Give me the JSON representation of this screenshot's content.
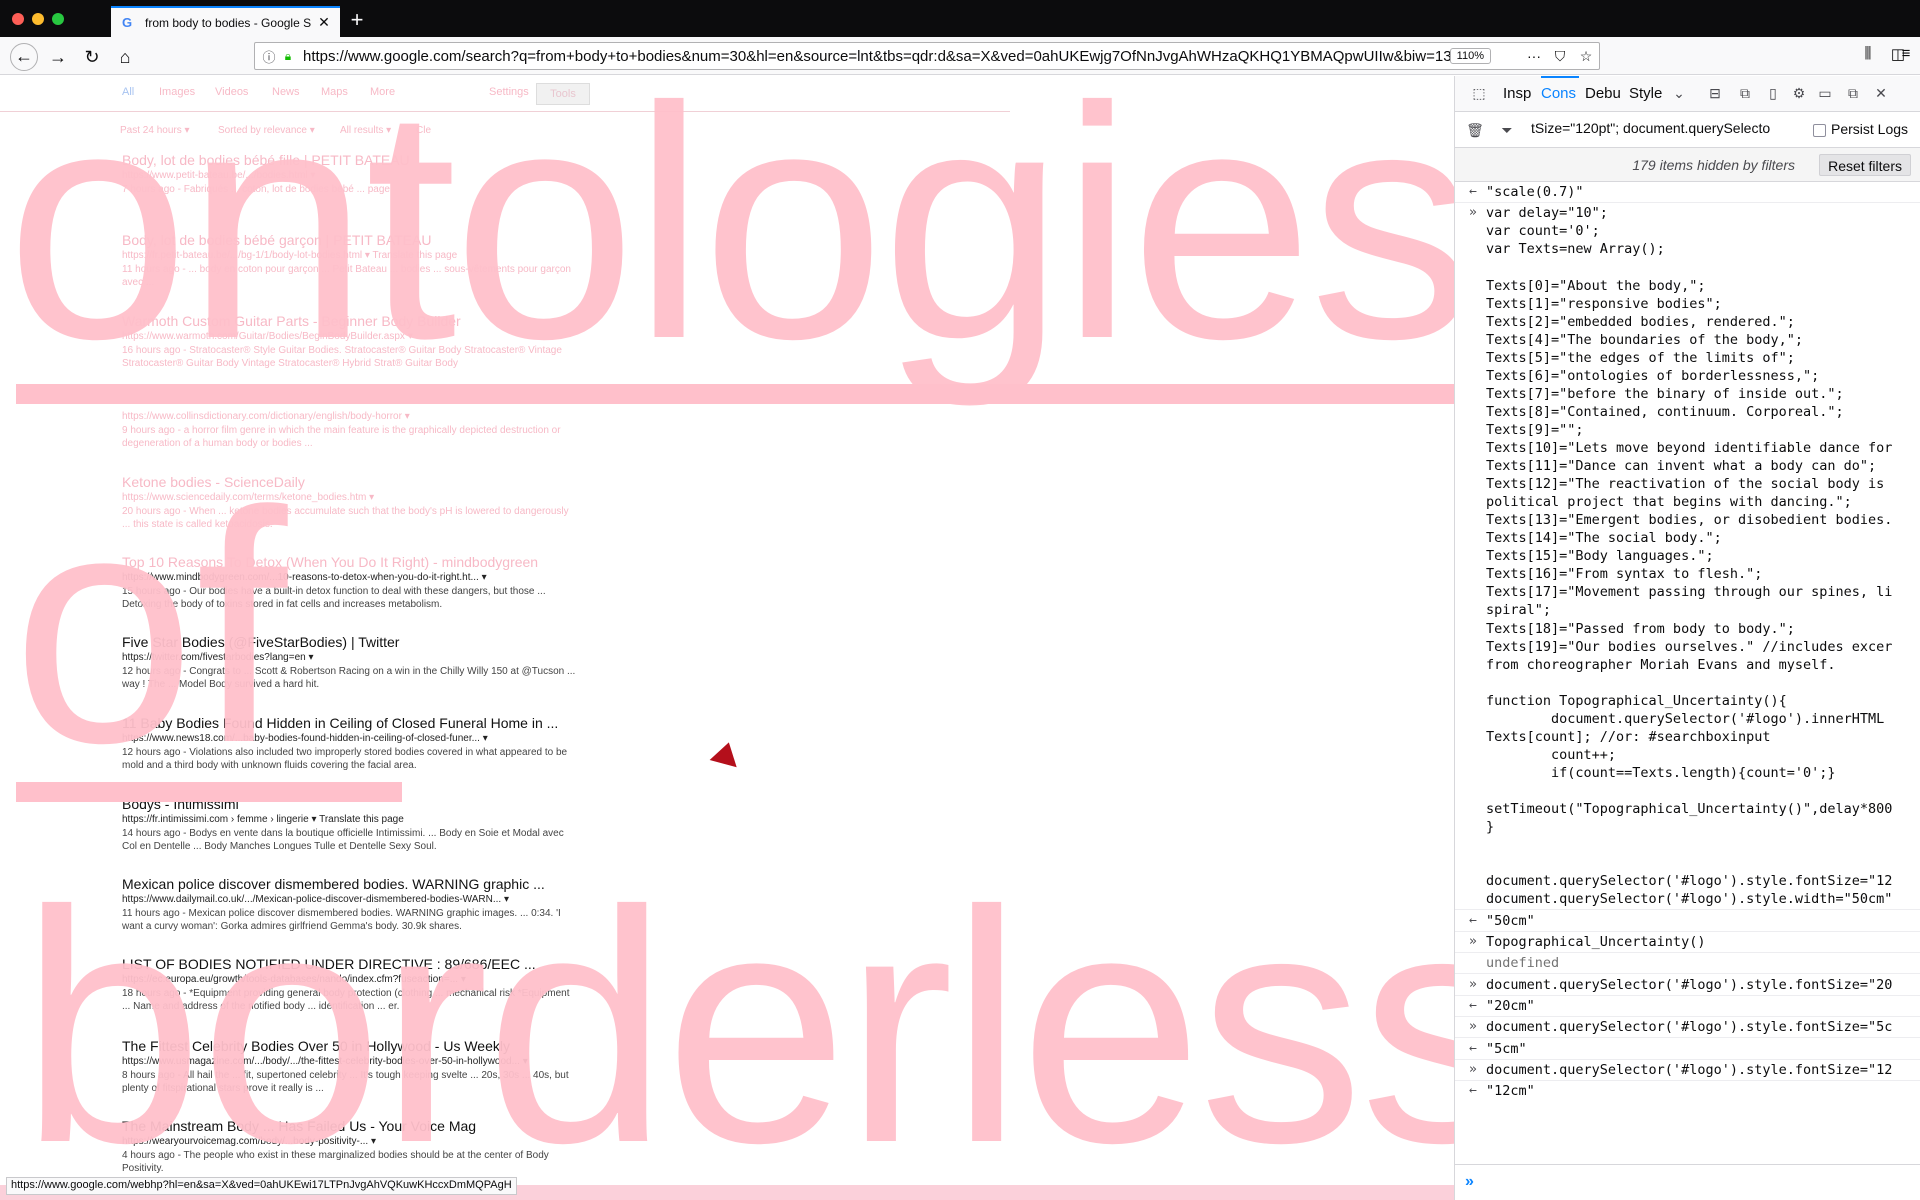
{
  "browser": {
    "tab_title": "from body to bodies - Google S",
    "tab_favicon": "G",
    "tab_close": "✕",
    "new_tab": "+",
    "url": "https://www.google.com/search?q=from+body+to+bodies&num=30&hl=en&source=lnt&tbs=qdr:d&sa=X&ved=0ahUKEwjg7OfNnJvgAhWHzaQKHQ1YBMAQpwUIIw&biw=1318&bih=1026",
    "zoom": "110%",
    "status_url": "https://www.google.com/webhp?hl=en&sa=X&ved=0ahUKEwi17LTPnJvgAhVQKuwKHccxDmMQPAgH"
  },
  "google": {
    "tabs": [
      "All",
      "Images",
      "Videos",
      "News",
      "Maps",
      "More"
    ],
    "settings": "Settings",
    "tools": "Tools",
    "filters": [
      "Past 24 hours ▾",
      "Sorted by relevance ▾",
      "All results ▾",
      "Cle"
    ],
    "results": [
      {
        "title": "Body, lot de bodies bébé fille | PETIT BATEAU",
        "url": "https://www.petit-bateau.be/.../bodies.html ▾",
        "snippet": "7 hours ago - Fabriqués ... coton, lot de bodies bébé ... page"
      },
      {
        "title": "Body, lot de bodies bébé garçon | PETIT BATEAU",
        "url": "https://fr.petit-bateau.be/.../bg-1/1/body-lot-bodies.html ▾ Translate this page",
        "snippet": "11 hours ago - ... body en coton pour garçon ... Petit Bateau ... bodies ... sous-vêtements pour garçon avec ..."
      },
      {
        "title": "Warmoth Custom Guitar Parts - Beginner Body Builder",
        "url": "https://www.warmoth.com/Guitar/Bodies/BeginBodyBuilder.aspx ▾",
        "snippet": "16 hours ago - Stratocaster® Style Guitar Bodies. Stratocaster® Guitar Body Stratocaster® Vintage Stratocaster® Guitar Body Vintage Stratocaster® Hybrid Strat® Guitar Body"
      },
      {
        "title": "",
        "url": "https://www.collinsdictionary.com/dictionary/english/body-horror ▾",
        "snippet": "9 hours ago - a horror film genre in which the main feature is the graphically depicted destruction or degeneration of a human body or bodies ..."
      },
      {
        "title": "Ketone bodies - ScienceDaily",
        "url": "https://www.sciencedaily.com/terms/ketone_bodies.htm ▾",
        "snippet": "20 hours ago - When ... ketone bodies accumulate such that the body's pH is lowered to dangerously ... this state is called ketoacidosis."
      },
      {
        "title": "Top 10 Reasons To Detox (When You Do It Right) - mindbodygreen",
        "url": "https://www.mindbodygreen.com/...10-reasons-to-detox-when-you-do-it-right.ht... ▾",
        "snippet": "15 hours ago - Our bodies have a built-in detox function to deal with these dangers, but those ... Detoxing the body of toxins stored in fat cells and increases metabolism."
      },
      {
        "title": "Five Star Bodies (@FiveStarBodies) | Twitter",
        "url": "https://twitter.com/fivestarbodies?lang=en ▾",
        "snippet": "12 hours ago - Congrats to ... Scott & Robertson Racing on a win in the Chilly Willy 150 at @Tucson ... way ! The ... Model Body survived a hard hit."
      },
      {
        "title": "11 Baby Bodies Found Hidden in Ceiling of Closed Funeral Home in ...",
        "url": "https://www.news18.com/...baby-bodies-found-hidden-in-ceiling-of-closed-funer... ▾",
        "snippet": "12 hours ago - Violations also included two improperly stored bodies covered in what appeared to be mold and a third body with unknown fluids covering the facial area."
      },
      {
        "title": "Bodys - Intimissimi",
        "url": "https://fr.intimissimi.com › femme › lingerie ▾ Translate this page",
        "snippet": "14 hours ago - Bodys en vente dans la boutique officielle Intimissimi. ... Body en Soie et Modal avec Col en Dentelle ... Body Manches Longues Tulle et Dentelle Sexy Soul."
      },
      {
        "title": "Mexican police discover dismembered bodies. WARNING graphic ...",
        "url": "https://www.dailymail.co.uk/.../Mexican-police-discover-dismembered-bodies-WARN... ▾",
        "snippet": "11 hours ago - Mexican police discover dismembered bodies. WARNING graphic images. ... 0:34. 'I want a curvy woman': Gorka admires girlfriend Gemma's body. 30.9k shares."
      },
      {
        "title": "LIST OF BODIES NOTIFIED UNDER DIRECTIVE : 89/686/EEC ...",
        "url": "https://ec.europa.eu/growth/tools-databases/nando/index.cfm?fuseaction=... ▾",
        "snippet": "18 hours ago - *Equipment providing general body protection (clothing ... mechanical risk *Equipment ... Name and address of the notified body ... identification ... er."
      },
      {
        "title": "The Fittest Celebrity Bodies Over 50 in Hollywood - Us Weekly",
        "url": "https://www.usmagazine.com/.../body/.../the-fittest-celebrity-bodies-over-50-in-hollywood... ▾",
        "snippet": "8 hours ago - All hail the ... fit, supertoned celebrity ... It's tough keeping svelte ... 20s, 30s ... 40s, but plenty of fitspirational stars prove it really is ..."
      },
      {
        "title": "The Mainstream Body ... Has Failed Us - Your Voice Mag",
        "url": "https://wearyourvoicemag.com/body/...body-positivity-... ▾",
        "snippet": "4 hours ago - The people who exist in these marginalized bodies should be at the center of Body Positivity."
      }
    ]
  },
  "logo_overlay": {
    "words": [
      "ontologies",
      "of",
      "borderless"
    ],
    "color": "#ffc0cb"
  },
  "devtools": {
    "tabs": [
      "Insp",
      "Cons",
      "Debu",
      "Style"
    ],
    "filter_text": "tSize=\"120pt\"; document.querySelecto",
    "persist_logs": "Persist Logs",
    "hidden_text": "179 items hidden by filters",
    "reset_filters": "Reset filters",
    "console_lines": [
      {
        "kind": "out",
        "pfx": "←",
        "text": "\"scale(0.7)\""
      },
      {
        "kind": "in",
        "pfx": "»",
        "text": "var delay=\"10\";"
      },
      {
        "kind": "cont",
        "pfx": "",
        "text": "var count='0';"
      },
      {
        "kind": "cont",
        "pfx": "",
        "text": "var Texts=new Array();"
      },
      {
        "kind": "cont",
        "pfx": "",
        "text": ""
      },
      {
        "kind": "cont",
        "pfx": "",
        "text": "Texts[0]=\"About the body,\";"
      },
      {
        "kind": "cont",
        "pfx": "",
        "text": "Texts[1]=\"responsive bodies\";"
      },
      {
        "kind": "cont",
        "pfx": "",
        "text": "Texts[2]=\"embedded bodies, rendered.\";"
      },
      {
        "kind": "cont",
        "pfx": "",
        "text": "Texts[4]=\"The boundaries of the body,\";"
      },
      {
        "kind": "cont",
        "pfx": "",
        "text": "Texts[5]=\"the edges of the limits of\";"
      },
      {
        "kind": "cont",
        "pfx": "",
        "text": "Texts[6]=\"ontologies of borderlessness,\";"
      },
      {
        "kind": "cont",
        "pfx": "",
        "text": "Texts[7]=\"before the binary of inside out.\";"
      },
      {
        "kind": "cont",
        "pfx": "",
        "text": "Texts[8]=\"Contained, continuum. Corporeal.\";"
      },
      {
        "kind": "cont",
        "pfx": "",
        "text": "Texts[9]=\"\";"
      },
      {
        "kind": "cont",
        "pfx": "",
        "text": "Texts[10]=\"Lets move beyond identifiable dance for"
      },
      {
        "kind": "cont",
        "pfx": "",
        "text": "Texts[11]=\"Dance can invent what a body can do\";"
      },
      {
        "kind": "cont",
        "pfx": "",
        "text": "Texts[12]=\"The reactivation of the social body is"
      },
      {
        "kind": "cont",
        "pfx": "",
        "text": "political project that begins with dancing.\";"
      },
      {
        "kind": "cont",
        "pfx": "",
        "text": "Texts[13]=\"Emergent bodies, or disobedient bodies."
      },
      {
        "kind": "cont",
        "pfx": "",
        "text": "Texts[14]=\"The social body.\";"
      },
      {
        "kind": "cont",
        "pfx": "",
        "text": "Texts[15]=\"Body languages.\";"
      },
      {
        "kind": "cont",
        "pfx": "",
        "text": "Texts[16]=\"From syntax to flesh.\";"
      },
      {
        "kind": "cont",
        "pfx": "",
        "text": "Texts[17]=\"Movement passing through our spines, li"
      },
      {
        "kind": "cont",
        "pfx": "",
        "text": "spiral\";"
      },
      {
        "kind": "cont",
        "pfx": "",
        "text": "Texts[18]=\"Passed from body to body.\";"
      },
      {
        "kind": "cont",
        "pfx": "",
        "text": "Texts[19]=\"Our bodies ourselves.\" //includes excer"
      },
      {
        "kind": "cont",
        "pfx": "",
        "text": "from choreographer Moriah Evans and myself."
      },
      {
        "kind": "cont",
        "pfx": "",
        "text": ""
      },
      {
        "kind": "cont",
        "pfx": "",
        "text": "function Topographical_Uncertainty(){"
      },
      {
        "kind": "cont",
        "pfx": "",
        "text": "        document.querySelector('#logo').innerHTML"
      },
      {
        "kind": "cont",
        "pfx": "",
        "text": "Texts[count]; //or: #searchboxinput"
      },
      {
        "kind": "cont",
        "pfx": "",
        "text": "        count++;"
      },
      {
        "kind": "cont",
        "pfx": "",
        "text": "        if(count==Texts.length){count='0';}"
      },
      {
        "kind": "cont",
        "pfx": "",
        "text": ""
      },
      {
        "kind": "cont",
        "pfx": "",
        "text": "setTimeout(\"Topographical_Uncertainty()\",delay*800"
      },
      {
        "kind": "cont",
        "pfx": "",
        "text": "}"
      },
      {
        "kind": "cont",
        "pfx": "",
        "text": ""
      },
      {
        "kind": "cont",
        "pfx": "",
        "text": ""
      },
      {
        "kind": "cont",
        "pfx": "",
        "text": "document.querySelector('#logo').style.fontSize=\"12"
      },
      {
        "kind": "cont",
        "pfx": "",
        "text": "document.querySelector('#logo').style.width=\"50cm\""
      },
      {
        "kind": "out",
        "pfx": "←",
        "text": "\"50cm\""
      },
      {
        "kind": "in",
        "pfx": "»",
        "text": "Topographical_Uncertainty()"
      },
      {
        "kind": "undef",
        "pfx": "",
        "text": "undefined"
      },
      {
        "kind": "in",
        "pfx": "»",
        "text": "document.querySelector('#logo').style.fontSize=\"20"
      },
      {
        "kind": "out",
        "pfx": "←",
        "text": "\"20cm\""
      },
      {
        "kind": "in",
        "pfx": "»",
        "text": "document.querySelector('#logo').style.fontSize=\"5c"
      },
      {
        "kind": "out",
        "pfx": "←",
        "text": "\"5cm\""
      },
      {
        "kind": "in",
        "pfx": "»",
        "text": "document.querySelector('#logo').style.fontSize=\"12"
      },
      {
        "kind": "out",
        "pfx": "←",
        "text": "\"12cm\""
      }
    ]
  }
}
